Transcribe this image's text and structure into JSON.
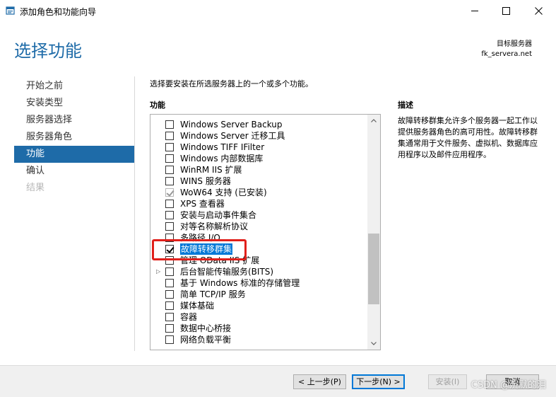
{
  "window": {
    "title": "添加角色和功能向导",
    "controls": {
      "minimize": "minimize-icon",
      "maximize": "maximize-icon",
      "close": "close-icon"
    }
  },
  "header": {
    "page_title": "选择功能",
    "dest_label": "目标服务器",
    "dest_server": "fk_servera.net"
  },
  "nav": {
    "items": [
      {
        "label": "开始之前",
        "state": "normal"
      },
      {
        "label": "安装类型",
        "state": "normal"
      },
      {
        "label": "服务器选择",
        "state": "normal"
      },
      {
        "label": "服务器角色",
        "state": "normal"
      },
      {
        "label": "功能",
        "state": "active"
      },
      {
        "label": "确认",
        "state": "normal"
      },
      {
        "label": "结果",
        "state": "disabled"
      }
    ]
  },
  "main": {
    "instruction": "选择要安装在所选服务器上的一个或多个功能。",
    "features_label": "功能",
    "features": [
      {
        "label": "Windows Server Backup",
        "checked": false,
        "grayed": false,
        "expandable": false
      },
      {
        "label": "Windows Server 迁移工具",
        "checked": false,
        "grayed": false,
        "expandable": false
      },
      {
        "label": "Windows TIFF IFilter",
        "checked": false,
        "grayed": false,
        "expandable": false
      },
      {
        "label": "Windows 内部数据库",
        "checked": false,
        "grayed": false,
        "expandable": false
      },
      {
        "label": "WinRM IIS 扩展",
        "checked": false,
        "grayed": false,
        "expandable": false
      },
      {
        "label": "WINS 服务器",
        "checked": false,
        "grayed": false,
        "expandable": false
      },
      {
        "label": "WoW64 支持 (已安装)",
        "checked": true,
        "grayed": true,
        "expandable": false
      },
      {
        "label": "XPS 查看器",
        "checked": false,
        "grayed": false,
        "expandable": false
      },
      {
        "label": "安装与启动事件集合",
        "checked": false,
        "grayed": false,
        "expandable": false
      },
      {
        "label": "对等名称解析协议",
        "checked": false,
        "grayed": false,
        "expandable": false
      },
      {
        "label": "多路径 I/O",
        "checked": false,
        "grayed": false,
        "expandable": false
      },
      {
        "label": "故障转移群集",
        "checked": true,
        "grayed": false,
        "expandable": false,
        "selected": true
      },
      {
        "label": "管理 OData IIS 扩展",
        "checked": false,
        "grayed": false,
        "expandable": false
      },
      {
        "label": "后台智能传输服务(BITS)",
        "checked": false,
        "grayed": false,
        "expandable": true
      },
      {
        "label": "基于 Windows 标准的存储管理",
        "checked": false,
        "grayed": false,
        "expandable": false
      },
      {
        "label": "简单 TCP/IP 服务",
        "checked": false,
        "grayed": false,
        "expandable": false
      },
      {
        "label": "媒体基础",
        "checked": false,
        "grayed": false,
        "expandable": false
      },
      {
        "label": "容器",
        "checked": false,
        "grayed": false,
        "expandable": false
      },
      {
        "label": "数据中心桥接",
        "checked": false,
        "grayed": false,
        "expandable": false
      },
      {
        "label": "网络负载平衡",
        "checked": false,
        "grayed": false,
        "expandable": false
      }
    ],
    "description_label": "描述",
    "description_text": "故障转移群集允许多个服务器一起工作以提供服务器角色的高可用性。故障转移群集通常用于文件服务、虚拟机、数据库应用程序以及邮件应用程序。"
  },
  "footer": {
    "prev_label": "< 上一步(P)",
    "next_label": "下一步(N) >",
    "install_label": "安装(I)",
    "cancel_label": "取消"
  },
  "watermark": "CSDN @沉默的泪",
  "colors": {
    "accent": "#1e6ba8",
    "selection": "#0078d7",
    "highlight_box": "#e0201b"
  }
}
